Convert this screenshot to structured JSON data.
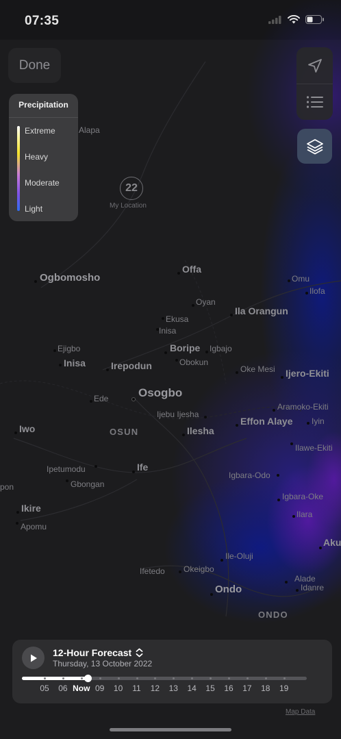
{
  "status_bar": {
    "time": "07:35",
    "icons": [
      "cellular-signal-icon",
      "wifi-icon",
      "battery-icon"
    ]
  },
  "top_controls": {
    "done_label": "Done",
    "icons": [
      "location-arrow-icon",
      "list-icon",
      "layers-icon"
    ]
  },
  "legend": {
    "title": "Precipitation",
    "items": [
      "Extreme",
      "Heavy",
      "Moderate",
      "Light"
    ],
    "gradient_colors": [
      "#ffffff",
      "#f3e22a",
      "#c77ad8",
      "#7e52e6",
      "#2e6df0"
    ]
  },
  "my_location": {
    "temperature": "22",
    "label": "My Location"
  },
  "map_labels": [
    "Alapa",
    "Ogbomosho",
    "Offa",
    "Omu",
    "Ilofa",
    "Oyan",
    "Ila Orangun",
    "Ekusa",
    "Inisa",
    "Boripe",
    "Igbajo",
    "Ejigbo",
    "Inisa",
    "Irepodun",
    "Obokun",
    "Oke Mesi",
    "Ijero-Ekiti",
    "Ede",
    "Osogbo",
    "Aramoko-Ekiti",
    "Ijebu Ijesha",
    "Iyin",
    "Iwo",
    "OSUN",
    "Ilesha",
    "Effon Alaye",
    "Ilawe-Ekiti",
    "Ipetumodu",
    "Ife",
    "Igbara-Odo",
    "pon",
    "Gbongan",
    "Igbara-Oke",
    "Ikire",
    "Ilara",
    "Apomu",
    "Ile-Oluji",
    "Aku",
    "Ifetedo",
    "Okeigbo",
    "Alade",
    "Idanre",
    "Ondo",
    "ONDO"
  ],
  "forecast": {
    "title": "12-Hour Forecast",
    "date": "Thursday, 13 October 2022",
    "hours": [
      "05",
      "06",
      "Now",
      "09",
      "10",
      "11",
      "12",
      "13",
      "14",
      "15",
      "16",
      "17",
      "18",
      "19"
    ],
    "current_hour": "Now",
    "progress": 0.23
  },
  "attribution": "Map Data",
  "colors": {
    "map_background": "#1c1c1e",
    "radar_dark_blue": "#0f1a7a",
    "radar_purple": "#3a1a8a",
    "layers_button_active": "#3d4a61"
  }
}
